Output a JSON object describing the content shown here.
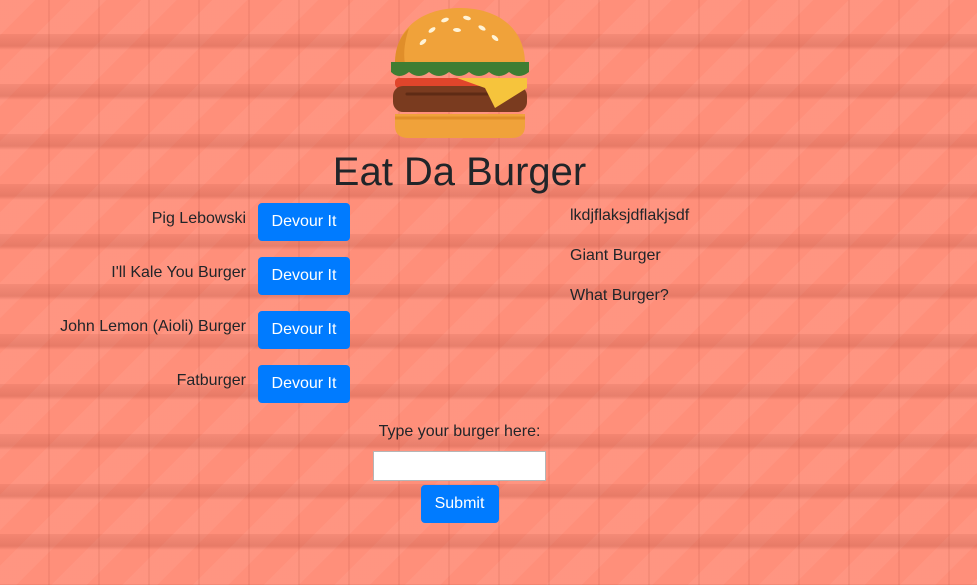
{
  "logo": {
    "icon": "burger-icon"
  },
  "page": {
    "title": "Eat Da Burger"
  },
  "uneaten": {
    "items": [
      {
        "name": "Pig Lebowski",
        "button": "Devour It"
      },
      {
        "name": "I'll Kale You Burger",
        "button": "Devour It"
      },
      {
        "name": "John Lemon (Aioli) Burger",
        "button": "Devour It"
      },
      {
        "name": "Fatburger",
        "button": "Devour It"
      }
    ]
  },
  "eaten": {
    "items": [
      "lkdjflaksjdflakjsdf",
      "Giant Burger",
      "What Burger?"
    ]
  },
  "form": {
    "label": "Type your burger here:",
    "input_value": "",
    "submit_label": "Submit"
  },
  "colors": {
    "background": "#ff8f7a",
    "button": "#007bff",
    "text": "#212529"
  }
}
